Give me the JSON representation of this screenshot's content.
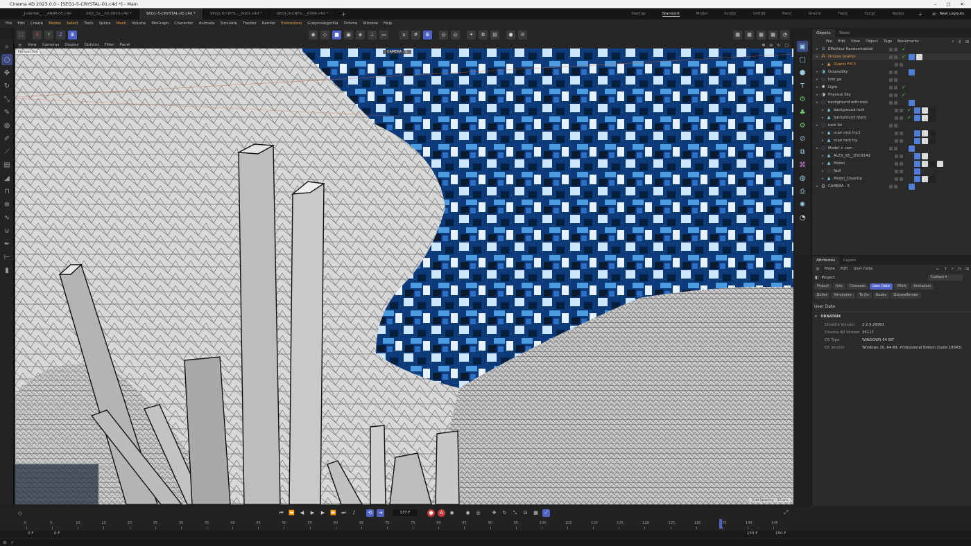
{
  "window": {
    "title": "Cinema 4D 2023.0.0 - [SEQ1-5-CRYSTAL-01.c4d *] - Main"
  },
  "doc_tabs": [
    "_Juliettek_..._ANIM-05.c4d",
    "SEQ_2a__02-0003.c4d *",
    "SEQ1-5-CRYSTAL-01.c4d *",
    "SEQ1-8-CRYS..._0001.c4d *",
    "SEQ1-9-CRYS..._0004.c4d *"
  ],
  "layout_tabs": [
    "Startup",
    "Standard",
    "Model",
    "Sculpt",
    "UVEdit",
    "Paint",
    "Groom",
    "Track",
    "Script",
    "Nodes"
  ],
  "new_layouts": "New Layouts",
  "menus": [
    "File",
    "Edit",
    "Create",
    "Modes",
    "Select",
    "Tools",
    "Spline",
    "Mesh",
    "Volume",
    "MoGraph",
    "Character",
    "Animate",
    "Simulate",
    "Tracker",
    "Render",
    "Extensions",
    "Greyscalegorilla",
    "Octane",
    "Window",
    "Help"
  ],
  "toolbar": {
    "axis_x": "X",
    "axis_y": "Y",
    "axis_z": "Z"
  },
  "view_menus": [
    "View",
    "Cameras",
    "Display",
    "Options",
    "Filter",
    "Panel"
  ],
  "viewport": {
    "mode_label": "Perspective",
    "camera_label": "CAMERA - 5",
    "grid_spacing": "Grid Spacing : 50 cm"
  },
  "object_tabs": [
    "Objects",
    "Takes"
  ],
  "object_menus": [
    "File",
    "Edit",
    "View",
    "Object",
    "Tags",
    "Bookmarks"
  ],
  "objects": [
    {
      "name": "Effecteur Randomisation",
      "indent": 0,
      "icon": "effector",
      "color": "#7ec8e3",
      "check": "✓",
      "tags": 0
    },
    {
      "name": "Octane Scatter",
      "indent": 0,
      "icon": "scatter",
      "color": "#e39a3b",
      "check": "✓",
      "tags": 2,
      "orange": true
    },
    {
      "name": "Quartz FM.5",
      "indent": 1,
      "icon": "mesh",
      "color": "#e39a3b",
      "check": "",
      "tags": 0,
      "orange": true
    },
    {
      "name": "OctaneSky",
      "indent": 0,
      "icon": "sky",
      "color": "#7ec8e3",
      "check": "",
      "tags": 1
    },
    {
      "name": "tete ga",
      "indent": 0,
      "icon": "null",
      "color": "#9ad",
      "check": "",
      "tags": 0
    },
    {
      "name": "Light",
      "indent": 0,
      "icon": "light",
      "color": "#ddd",
      "check": "✓",
      "tags": 0
    },
    {
      "name": "Physical Sky",
      "indent": 0,
      "icon": "sky",
      "color": "#ddd",
      "check": "✓",
      "tags": 0
    },
    {
      "name": "background with rock",
      "indent": 0,
      "icon": "null",
      "color": "#9ad",
      "check": "",
      "tags": 1
    },
    {
      "name": "background rock",
      "indent": 1,
      "icon": "mesh",
      "color": "#7ec8e3",
      "check": "✓",
      "tags": 3
    },
    {
      "name": "background black",
      "indent": 1,
      "icon": "mesh",
      "color": "#7ec8e3",
      "check": "✓",
      "tags": 3
    },
    {
      "name": "rock 3d",
      "indent": 0,
      "icon": "null",
      "color": "#9ad",
      "check": "",
      "tags": 0
    },
    {
      "name": "scan rock try.1",
      "indent": 1,
      "icon": "mesh",
      "color": "#7ec8e3",
      "check": "",
      "tags": 3
    },
    {
      "name": "scan rock try",
      "indent": 1,
      "icon": "mesh",
      "color": "#7ec8e3",
      "check": "",
      "tags": 3
    },
    {
      "name": "Model + cam",
      "indent": 0,
      "icon": "null",
      "color": "#9ad",
      "check": "",
      "tags": 1
    },
    {
      "name": "ALEX_08__DSC9142",
      "indent": 1,
      "icon": "mesh",
      "color": "#7ec8e3",
      "check": "",
      "tags": 2
    },
    {
      "name": "Model",
      "indent": 1,
      "icon": "mesh",
      "color": "#7ec8e3",
      "check": "",
      "tags": 4
    },
    {
      "name": "Null",
      "indent": 1,
      "icon": "null",
      "color": "#9ad",
      "check": "",
      "tags": 1
    },
    {
      "name": "Model_CleanUp",
      "indent": 1,
      "icon": "mesh",
      "color": "#7ec8e3",
      "check": "",
      "tags": 3
    },
    {
      "name": "CAMERA - 5",
      "indent": 0,
      "icon": "camera",
      "color": "#ddd",
      "check": "",
      "tags": 1
    }
  ],
  "attr_tabs": [
    "Attributes",
    "Layers"
  ],
  "attr_menus": [
    "Mode",
    "Edit",
    "User Data"
  ],
  "attr": {
    "title": "Project",
    "dropdown": "Custom",
    "buttons_row1": [
      "Project",
      "Info",
      "Cineware",
      "User Data",
      "XRefs",
      "Animation"
    ],
    "buttons_row2": [
      "Bullet",
      "Simulation",
      "To Do",
      "Nodes",
      "OctaneRender"
    ],
    "active_button": "User Data",
    "section": "User Data",
    "group": "ORNATRIX",
    "fields": [
      {
        "k": "Ornatrix Version",
        "v": "2.2.9.29361"
      },
      {
        "k": "Cinema 4D Version",
        "v": "25117"
      },
      {
        "k": "OS Type",
        "v": "WINDOWS 64 BIT"
      },
      {
        "k": "OS Version",
        "v": "Windows 10, 64 Bit, Professional Edition (build 19043)"
      }
    ]
  },
  "timeline": {
    "ticks": [
      "0",
      "5",
      "10",
      "15",
      "20",
      "25",
      "30",
      "35",
      "40",
      "45",
      "50",
      "55",
      "60",
      "65",
      "70",
      "75",
      "80",
      "85",
      "90",
      "95",
      "100",
      "105",
      "110",
      "115",
      "120",
      "125",
      "130",
      "135",
      "140",
      "145"
    ],
    "current_frame": "137 F",
    "start_a": "0 F",
    "start_b": "0 F",
    "end_a": "150 F",
    "end_b": "150 F",
    "playhead_fraction": 0.913
  },
  "colors": {
    "accent": "#4f63c7",
    "check": "#5bd05b",
    "orange": "#e39a3b"
  }
}
